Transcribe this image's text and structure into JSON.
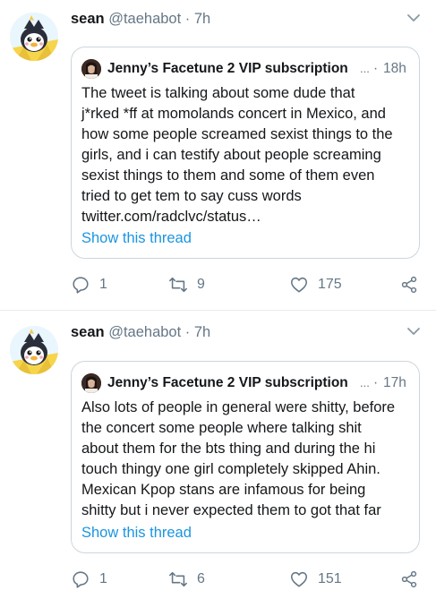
{
  "colors": {
    "text": "#14171a",
    "secondary": "#657786",
    "link": "#1b95e0",
    "border": "#ccd6dd"
  },
  "tweets": [
    {
      "author_name": "sean",
      "handle": "@taehabot",
      "separator": "·",
      "time": "7h",
      "menu_icon": "chevron-down-icon",
      "quote": {
        "author_name": "Jenny’s Facetune 2 VIP subscription",
        "truncation": "...",
        "separator": "·",
        "time": "18h",
        "text_lines": [
          "The tweet is talking about some dude that",
          "j*rked *ff at momolands concert in Mexico, and",
          "how some people screamed sexist things to the",
          "girls, and i can testify about people screaming",
          "sexist things to them and some of them even",
          "tried to get tem to say cuss words",
          "twitter.com/radclvc/status…"
        ],
        "show_thread": "Show this thread"
      },
      "actions": {
        "reply_count": "1",
        "retweet_count": "9",
        "like_count": "175"
      }
    },
    {
      "author_name": "sean",
      "handle": "@taehabot",
      "separator": "·",
      "time": "7h",
      "menu_icon": "chevron-down-icon",
      "quote": {
        "author_name": "Jenny’s Facetune 2 VIP subscription",
        "truncation": "...",
        "separator": "·",
        "time": "17h",
        "text_lines": [
          "Also lots of people in general were shitty, before",
          "the concert some people where talking shit",
          "about them for the bts thing and during the hi",
          "touch thingy one girl completely skipped Ahin.",
          "Mexican Kpop stans are infamous for being",
          "shitty but i never expected them to got that far"
        ],
        "show_thread": "Show this thread"
      },
      "actions": {
        "reply_count": "1",
        "retweet_count": "6",
        "like_count": "151"
      }
    }
  ]
}
